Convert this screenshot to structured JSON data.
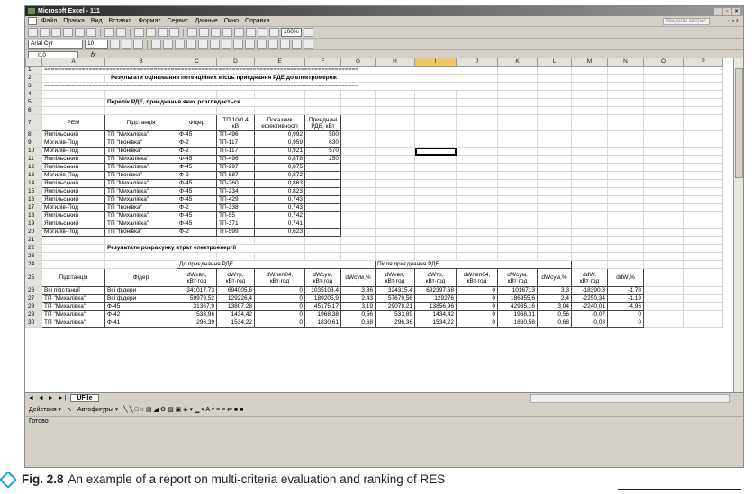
{
  "window": {
    "title": "Microsoft Excel - 111",
    "controls": [
      "_",
      "▫",
      "×"
    ]
  },
  "menu": {
    "items": [
      "Файл",
      "Правка",
      "Вид",
      "Вставка",
      "Формат",
      "Сервис",
      "Данные",
      "Окно",
      "Справка"
    ],
    "ask_placeholder": "Введите вопрос",
    "right_controls": "- ▫ ×"
  },
  "toolbar": {
    "zoom": "100%",
    "font": "Arial Cyr",
    "size": "10"
  },
  "formula_bar": {
    "name_box": "I10",
    "fx": "fx",
    "content": ""
  },
  "sheet": {
    "columns": [
      "A",
      "B",
      "C",
      "D",
      "E",
      "F",
      "G",
      "H",
      "I",
      "J",
      "K",
      "L",
      "M",
      "N",
      "O",
      "P"
    ],
    "active_column": "I",
    "separator": "============================================================================================",
    "title1": "Результати оцінювання потенційних місць приєднання РДЕ до електромереж",
    "title2": "Перелік РДЕ, приєднання яких розглядається",
    "title3": "Результати розрахунку втрат електроенергії",
    "t1_headers": [
      "РЕМ",
      "Підстанція",
      "Фідер",
      "ТП 10/0,4 кВ",
      "Показник ефективності",
      "Приєднані РДЕ, кВт"
    ],
    "t1_rows": [
      {
        "r": "8",
        "a": "Ямпільський",
        "b": "ТП \"Михалівка\"",
        "c": "Ф-45",
        "d": "ТП-496",
        "e": "0,992",
        "f": "500"
      },
      {
        "r": "9",
        "a": "Могилів-Под",
        "b": "ТП \"Івонівка\"",
        "c": "Ф-2",
        "d": "ТП-117",
        "e": "0,959",
        "f": "630"
      },
      {
        "r": "10",
        "a": "Могилів-Под",
        "b": "ТП \"Івонівка\"",
        "c": "Ф-2",
        "d": "ТП-117",
        "e": "0,921",
        "f": "570"
      },
      {
        "r": "11",
        "a": "Ямпільський",
        "b": "ТП \"Михалівка\"",
        "c": "Ф-45",
        "d": "ТП-496",
        "e": "0,878",
        "f": "250"
      },
      {
        "r": "12",
        "a": "Ямпільський",
        "b": "ТП \"Михалівка\"",
        "c": "Ф-45",
        "d": "ТП-297",
        "e": "0,875",
        "f": ""
      },
      {
        "r": "13",
        "a": "Могилів-Под",
        "b": "ТП \"Івонівка\"",
        "c": "Ф-2",
        "d": "ТП-587",
        "e": "0,872",
        "f": ""
      },
      {
        "r": "14",
        "a": "Ямпільський",
        "b": "ТП \"Михалівка\"",
        "c": "Ф-45",
        "d": "ТП-260",
        "e": "0,863",
        "f": ""
      },
      {
        "r": "15",
        "a": "Ямпільський",
        "b": "ТП \"Михалівка\"",
        "c": "Ф-45",
        "d": "ТП-234",
        "e": "0,823",
        "f": ""
      },
      {
        "r": "16",
        "a": "Ямпільський",
        "b": "ТП \"Михалівка\"",
        "c": "Ф-45",
        "d": "ТП-429",
        "e": "0,743",
        "f": ""
      },
      {
        "r": "17",
        "a": "Могилів-Под",
        "b": "ТП \"Івонівка\"",
        "c": "Ф-2",
        "d": "ТП-338",
        "e": "0,743",
        "f": ""
      },
      {
        "r": "18",
        "a": "Ямпільський",
        "b": "ТП \"Михалівка\"",
        "c": "Ф-45",
        "d": "ТП-55",
        "e": "0,742",
        "f": ""
      },
      {
        "r": "19",
        "a": "Ямпільський",
        "b": "ТП \"Михалівка\"",
        "c": "Ф-45",
        "d": "ТП-371",
        "e": "0,741",
        "f": ""
      },
      {
        "r": "20",
        "a": "Могилів-Под",
        "b": "ТП \"Івонівка\"",
        "c": "Ф-2",
        "d": "ТП-599",
        "e": "0,623",
        "f": ""
      }
    ],
    "t2_group_before": "До приєднання РДЕ",
    "t2_group_after": "Після приєднання РДЕ",
    "t2_headers": [
      "Підстанція",
      "Фідер",
      "dWхвп, кВт·год",
      "dWтр, кВт·год",
      "dWлеп04, кВт·год",
      "dWсум, кВт·год",
      "dWсум,%",
      "dWхвп, кВт·год",
      "dWтр, кВт·год",
      "dWлеп04, кВт·год",
      "dWсум, кВт·год",
      "dWсум,%",
      "ddW, кВт·год",
      "ddW,%"
    ],
    "t2_rows": [
      {
        "r": "26",
        "a": "Всі підстанції",
        "b": "Всі фідери",
        "c": "341017,73",
        "d": "694005,6",
        "e": "0",
        "f": "1035103,4",
        "g": "3,36",
        "h": "324315,4",
        "i": "692397,68",
        "j": "0",
        "k": "1016713",
        "l": "3,3",
        "m": "-18390,3",
        "n": "-1,78"
      },
      {
        "r": "27",
        "a": "ТП \"Михалівка\"",
        "b": "Всі фідери",
        "c": "59979,52",
        "d": "129226,4",
        "e": "0",
        "f": "189205,9",
        "g": "2,43",
        "h": "57679,56",
        "i": "129276",
        "j": "0",
        "k": "186955,6",
        "l": "2,4",
        "m": "-2250,34",
        "n": "-1,19"
      },
      {
        "r": "28",
        "a": "ТП \"Михалівка\"",
        "b": "Ф-45",
        "c": "31367,9",
        "d": "13807,28",
        "e": "0",
        "f": "45175,17",
        "g": "3,19",
        "h": "29078,21",
        "i": "13856,96",
        "j": "0",
        "k": "42935,16",
        "l": "3,04",
        "m": "-2240,01",
        "n": "-4,96"
      },
      {
        "r": "29",
        "a": "ТП \"Михалівка\"",
        "b": "Ф-42",
        "c": "533,96",
        "d": "1434,42",
        "e": "0",
        "f": "1968,38",
        "g": "0,56",
        "h": "533,89",
        "i": "1434,42",
        "j": "0",
        "k": "1968,31",
        "l": "0,56",
        "m": "-0,07",
        "n": "0"
      },
      {
        "r": "30",
        "a": "ТП \"Михалівка\"",
        "b": "Ф-41",
        "c": "296,39",
        "d": "1534,22",
        "e": "0",
        "f": "1830,61",
        "g": "0,68",
        "h": "296,36",
        "i": "1534,22",
        "j": "0",
        "k": "1830,58",
        "l": "0,68",
        "m": "-0,03",
        "n": "0"
      }
    ]
  },
  "sheet_tab": "UFile",
  "sheet_nav": "◄ ◄ ► ►|",
  "drawbar": {
    "actions": "Действия ▾",
    "autoshapes": "Автофигуры ▾",
    "shapes": "╲ ╲ □ ○ ▤ ◢ ⚙ ▨ ▣ ◈ ▾ ▁ ▾ A ▾ ≡ ≡ ⇄ ■ ■"
  },
  "status": "Готово",
  "caption": {
    "label": "Fig. 2.8",
    "text": "An example of a report on multi-criteria evaluation and ranking of RES"
  }
}
